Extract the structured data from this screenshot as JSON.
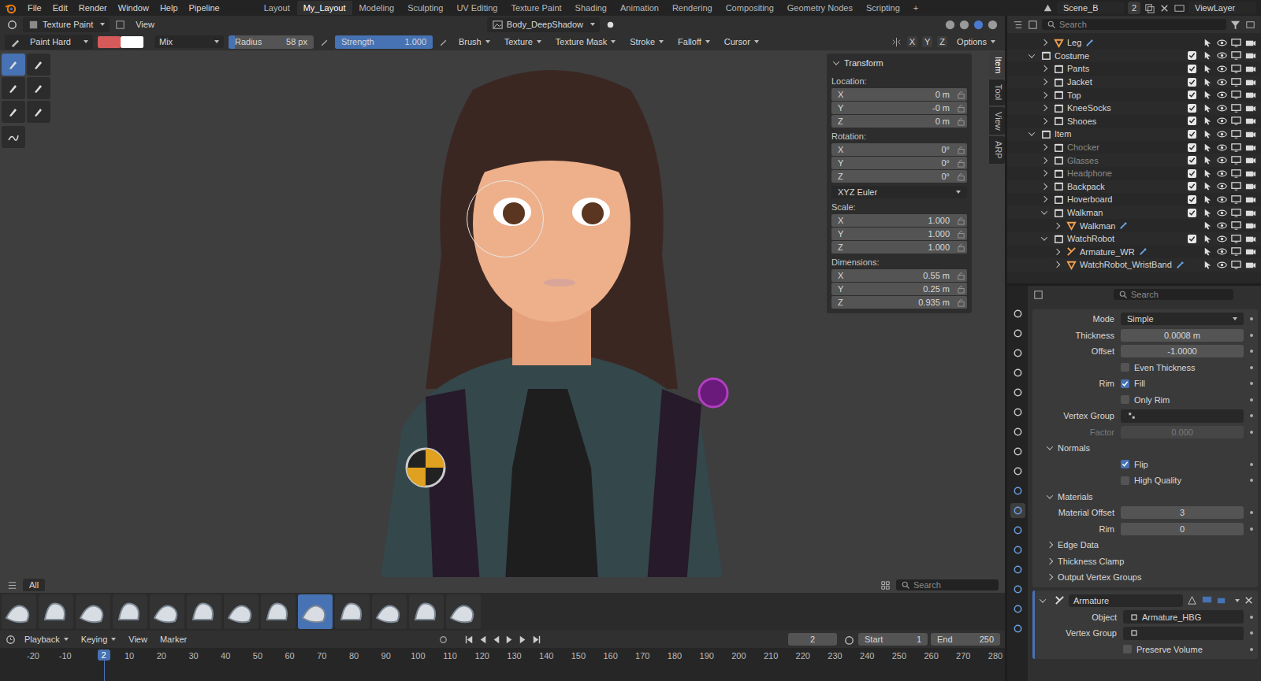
{
  "window": {
    "title": "Blender"
  },
  "menu": [
    "File",
    "Edit",
    "Render",
    "Window",
    "Help",
    "Pipeline"
  ],
  "workspaces": [
    {
      "label": "Layout",
      "selected": false
    },
    {
      "label": "My_Layout",
      "selected": true
    },
    {
      "label": "Modeling",
      "selected": false
    },
    {
      "label": "Sculpting",
      "selected": false
    },
    {
      "label": "UV Editing",
      "selected": false
    },
    {
      "label": "Texture Paint",
      "selected": false
    },
    {
      "label": "Shading",
      "selected": false
    },
    {
      "label": "Animation",
      "selected": false
    },
    {
      "label": "Rendering",
      "selected": false
    },
    {
      "label": "Compositing",
      "selected": false
    },
    {
      "label": "Geometry Nodes",
      "selected": false
    },
    {
      "label": "Scripting",
      "selected": false
    }
  ],
  "add_workspace": "+",
  "scene": {
    "name": "Scene_B",
    "users": "2",
    "view_layer": "ViewLayer"
  },
  "viewport_header": {
    "mode": "Texture Paint",
    "view": "View",
    "image": "Body_DeepShadow"
  },
  "tool_settings": {
    "brush": "Paint Hard",
    "primary_color": "#d55b5b",
    "secondary_color": "#ffffff",
    "blend": "Mix",
    "radius_label": "Radius",
    "radius": "58 px",
    "strength_label": "Strength",
    "strength": "1.000",
    "strength_level": 1.0,
    "menus": [
      "Brush",
      "Texture",
      "Texture Mask",
      "Stroke",
      "Falloff",
      "Cursor"
    ],
    "axes": [
      "X",
      "Y",
      "Z"
    ],
    "options": "Options"
  },
  "tools": [
    {
      "selected": true
    },
    {
      "selected": false
    },
    {
      "selected": false
    },
    {
      "selected": false
    },
    {
      "selected": false
    },
    {
      "selected": false
    },
    {
      "selected": false
    }
  ],
  "n_panel": {
    "title": "Transform",
    "groups": [
      {
        "label": "Location:",
        "rows": [
          {
            "axis": "X",
            "value": "0 m"
          },
          {
            "axis": "Y",
            "value": "-0 m"
          },
          {
            "axis": "Z",
            "value": "0 m"
          }
        ]
      },
      {
        "label": "Rotation:",
        "rows": [
          {
            "axis": "X",
            "value": "0°"
          },
          {
            "axis": "Y",
            "value": "0°"
          },
          {
            "axis": "Z",
            "value": "0°"
          }
        ],
        "mode": "XYZ Euler"
      },
      {
        "label": "Scale:",
        "rows": [
          {
            "axis": "X",
            "value": "1.000"
          },
          {
            "axis": "Y",
            "value": "1.000"
          },
          {
            "axis": "Z",
            "value": "1.000"
          }
        ]
      },
      {
        "label": "Dimensions:",
        "rows": [
          {
            "axis": "X",
            "value": "0.55 m"
          },
          {
            "axis": "Y",
            "value": "0.25 m"
          },
          {
            "axis": "Z",
            "value": "0.935 m"
          }
        ]
      }
    ],
    "tabs": [
      {
        "label": "Item",
        "selected": true
      },
      {
        "label": "Tool",
        "selected": false
      },
      {
        "label": "View",
        "selected": false
      },
      {
        "label": "ARP",
        "selected": false
      }
    ]
  },
  "asset_shelf": {
    "tab": "All",
    "search_placeholder": "Search",
    "brushes": [
      {
        "selected": false
      },
      {
        "selected": false
      },
      {
        "selected": false
      },
      {
        "selected": false
      },
      {
        "selected": false
      },
      {
        "selected": false
      },
      {
        "selected": false
      },
      {
        "selected": false
      },
      {
        "selected": true
      },
      {
        "selected": false
      },
      {
        "selected": false
      },
      {
        "selected": false
      },
      {
        "selected": false
      }
    ]
  },
  "timeline": {
    "menus": [
      "Playback",
      "Keying",
      "View",
      "Marker"
    ],
    "current_frame": "2",
    "start_label": "Start",
    "start": "1",
    "end_label": "End",
    "end": "250",
    "ticks": [
      "-20",
      "-10",
      "10",
      "20",
      "30",
      "40",
      "50",
      "60",
      "70",
      "80",
      "90",
      "100",
      "110",
      "120",
      "130",
      "140",
      "150",
      "160",
      "170",
      "180",
      "190",
      "200",
      "210",
      "220",
      "230",
      "240",
      "250",
      "260",
      "270",
      "280"
    ]
  },
  "outliner": {
    "search_placeholder": "Search",
    "rows": [
      {
        "name": "Leg",
        "depth": 2,
        "kind": "mesh",
        "expanded": false,
        "disabled": false,
        "checked": false
      },
      {
        "name": "Costume",
        "depth": 1,
        "kind": "collection",
        "expanded": true,
        "disabled": false,
        "checked": true
      },
      {
        "name": "Pants",
        "depth": 2,
        "kind": "collection",
        "expanded": false,
        "disabled": false,
        "checked": true
      },
      {
        "name": "Jacket",
        "depth": 2,
        "kind": "collection",
        "expanded": false,
        "disabled": false,
        "checked": true
      },
      {
        "name": "Top",
        "depth": 2,
        "kind": "collection",
        "expanded": false,
        "disabled": false,
        "checked": true
      },
      {
        "name": "KneeSocks",
        "depth": 2,
        "kind": "collection",
        "expanded": false,
        "disabled": false,
        "checked": true
      },
      {
        "name": "Shooes",
        "depth": 2,
        "kind": "collection",
        "expanded": false,
        "disabled": false,
        "checked": true
      },
      {
        "name": "Item",
        "depth": 1,
        "kind": "collection",
        "expanded": true,
        "disabled": false,
        "checked": true
      },
      {
        "name": "Chocker",
        "depth": 2,
        "kind": "collection",
        "expanded": false,
        "disabled": true,
        "checked": true
      },
      {
        "name": "Glasses",
        "depth": 2,
        "kind": "collection",
        "expanded": false,
        "disabled": true,
        "checked": true
      },
      {
        "name": "Headphone",
        "depth": 2,
        "kind": "collection",
        "expanded": false,
        "disabled": true,
        "checked": true
      },
      {
        "name": "Backpack",
        "depth": 2,
        "kind": "collection",
        "expanded": false,
        "disabled": false,
        "checked": true
      },
      {
        "name": "Hoverboard",
        "depth": 2,
        "kind": "collection",
        "expanded": false,
        "disabled": false,
        "checked": true
      },
      {
        "name": "Walkman",
        "depth": 2,
        "kind": "collection",
        "expanded": true,
        "disabled": false,
        "checked": true
      },
      {
        "name": "Walkman",
        "depth": 3,
        "kind": "mesh",
        "expanded": false,
        "disabled": false,
        "checked": false
      },
      {
        "name": "WatchRobot",
        "depth": 2,
        "kind": "collection",
        "expanded": true,
        "disabled": false,
        "checked": true
      },
      {
        "name": "Armature_WR",
        "depth": 3,
        "kind": "armature",
        "expanded": false,
        "disabled": false,
        "checked": false
      },
      {
        "name": "WatchRobot_WristBand",
        "depth": 3,
        "kind": "mesh",
        "expanded": false,
        "disabled": false,
        "checked": false
      }
    ]
  },
  "properties": {
    "search_placeholder": "Search",
    "rows": [
      {
        "kind": "field",
        "label": "Mode",
        "value": "Simple",
        "dropdown": true,
        "disabled": false
      },
      {
        "kind": "field",
        "label": "Thickness",
        "value": "0.0008 m",
        "dropdown": false,
        "disabled": false
      },
      {
        "kind": "field",
        "label": "Offset",
        "value": "-1.0000",
        "dropdown": false,
        "disabled": false
      },
      {
        "kind": "check",
        "label": "",
        "text": "Even Thickness",
        "checked": false
      },
      {
        "kind": "check",
        "label": "Rim",
        "text": "Fill",
        "checked": true
      },
      {
        "kind": "check",
        "label": "",
        "text": "Only Rim",
        "checked": false
      },
      {
        "kind": "group",
        "label": "Vertex Group",
        "value": ""
      },
      {
        "kind": "field",
        "label": "Factor",
        "value": "0.000",
        "dropdown": false,
        "disabled": true
      },
      {
        "kind": "section",
        "text": "Normals",
        "expanded": true
      },
      {
        "kind": "check",
        "label": "",
        "text": "Flip",
        "checked": true
      },
      {
        "kind": "check",
        "label": "",
        "text": "High Quality",
        "checked": false
      },
      {
        "kind": "section",
        "text": "Materials",
        "expanded": true
      },
      {
        "kind": "field",
        "label": "Material Offset",
        "value": "3",
        "dropdown": false,
        "disabled": false
      },
      {
        "kind": "field",
        "label": "Rim",
        "value": "0",
        "dropdown": false,
        "disabled": false
      },
      {
        "kind": "section",
        "text": "Edge Data",
        "expanded": false
      },
      {
        "kind": "section",
        "text": "Thickness Clamp",
        "expanded": false
      },
      {
        "kind": "section",
        "text": "Output Vertex Groups",
        "expanded": false
      }
    ],
    "armature": {
      "name": "Armature",
      "rows": [
        {
          "kind": "group",
          "label": "Object",
          "value": "Armature_HBG"
        },
        {
          "kind": "group",
          "label": "Vertex Group",
          "value": ""
        },
        {
          "kind": "check",
          "label": "",
          "text": "Preserve Volume",
          "checked": false
        }
      ]
    }
  }
}
